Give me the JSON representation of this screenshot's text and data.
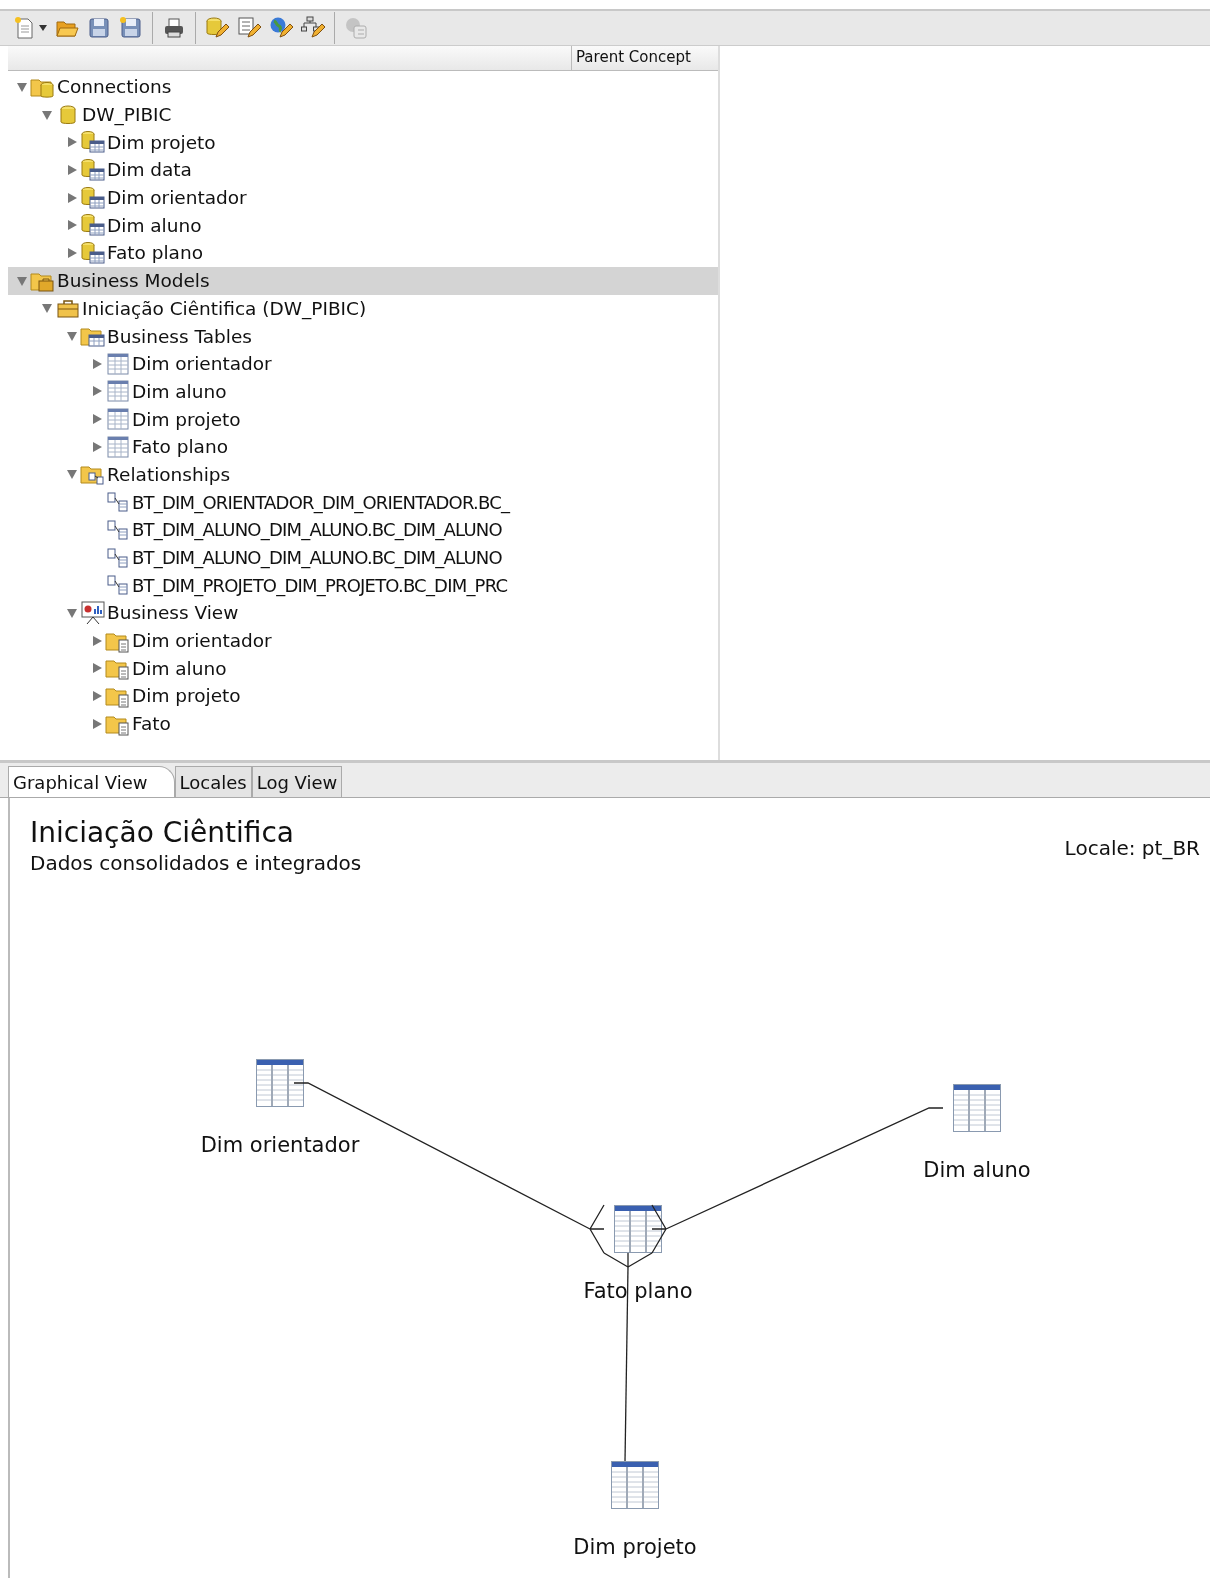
{
  "toolbar": {
    "buttons": [
      {
        "kind": "new",
        "disabled": false,
        "dropdown": true
      },
      {
        "kind": "open",
        "disabled": false,
        "dropdown": false
      },
      {
        "kind": "save",
        "disabled": false,
        "dropdown": false
      },
      {
        "kind": "save-as",
        "disabled": false,
        "dropdown": false
      },
      {
        "kind": "print",
        "disabled": false,
        "dropdown": false
      },
      {
        "kind": "edit-connection",
        "disabled": false,
        "dropdown": false
      },
      {
        "kind": "edit-table",
        "disabled": false,
        "dropdown": false
      },
      {
        "kind": "edit-locale",
        "disabled": false,
        "dropdown": false
      },
      {
        "kind": "edit-hierarchy",
        "disabled": false,
        "dropdown": false
      },
      {
        "kind": "security",
        "disabled": true,
        "dropdown": false
      }
    ]
  },
  "tree": {
    "column_header": "Parent Concept",
    "items": [
      {
        "label": "Connections",
        "kind": "connections",
        "expanded": true,
        "selected": false,
        "children": [
          {
            "label": "DW_PIBIC",
            "kind": "database",
            "expanded": true,
            "selected": false,
            "children": [
              {
                "label": "Dim projeto",
                "kind": "physical-table",
                "expanded": false,
                "selected": false
              },
              {
                "label": "Dim data",
                "kind": "physical-table",
                "expanded": false,
                "selected": false
              },
              {
                "label": "Dim orientador",
                "kind": "physical-table",
                "expanded": false,
                "selected": false
              },
              {
                "label": "Dim aluno",
                "kind": "physical-table",
                "expanded": false,
                "selected": false
              },
              {
                "label": "Fato plano",
                "kind": "physical-table",
                "expanded": false,
                "selected": false
              }
            ]
          }
        ]
      },
      {
        "label": "Business Models",
        "kind": "business-models",
        "expanded": true,
        "selected": true,
        "children": [
          {
            "label": "Iniciação Ciêntifica (DW_PIBIC)",
            "kind": "model",
            "expanded": true,
            "selected": false,
            "children": [
              {
                "label": "Business Tables",
                "kind": "tables-folder",
                "expanded": true,
                "selected": false,
                "children": [
                  {
                    "label": "Dim orientador",
                    "kind": "business-table",
                    "expanded": false,
                    "selected": false
                  },
                  {
                    "label": "Dim aluno",
                    "kind": "business-table",
                    "expanded": false,
                    "selected": false
                  },
                  {
                    "label": "Dim projeto",
                    "kind": "business-table",
                    "expanded": false,
                    "selected": false
                  },
                  {
                    "label": "Fato plano",
                    "kind": "business-table",
                    "expanded": false,
                    "selected": false
                  }
                ]
              },
              {
                "label": "Relationships",
                "kind": "relationships-folder",
                "expanded": true,
                "selected": false,
                "children": [
                  {
                    "label": "BT_DIM_ORIENTADOR_DIM_ORIENTADOR.BC_",
                    "kind": "relationship",
                    "selected": false
                  },
                  {
                    "label": "BT_DIM_ALUNO_DIM_ALUNO.BC_DIM_ALUNO",
                    "kind": "relationship",
                    "selected": false
                  },
                  {
                    "label": "BT_DIM_ALUNO_DIM_ALUNO.BC_DIM_ALUNO",
                    "kind": "relationship",
                    "selected": false
                  },
                  {
                    "label": "BT_DIM_PROJETO_DIM_PROJETO.BC_DIM_PRC",
                    "kind": "relationship",
                    "selected": false
                  }
                ]
              },
              {
                "label": "Business View",
                "kind": "business-view",
                "expanded": true,
                "selected": false,
                "children": [
                  {
                    "label": "Dim orientador",
                    "kind": "category",
                    "expanded": false,
                    "selected": false
                  },
                  {
                    "label": "Dim aluno",
                    "kind": "category",
                    "expanded": false,
                    "selected": false
                  },
                  {
                    "label": "Dim projeto",
                    "kind": "category",
                    "expanded": false,
                    "selected": false
                  },
                  {
                    "label": "Fato",
                    "kind": "category",
                    "expanded": false,
                    "selected": false
                  }
                ]
              }
            ]
          }
        ]
      }
    ]
  },
  "tabs": [
    {
      "label": "Graphical View",
      "selected": true
    },
    {
      "label": "Locales",
      "selected": false
    },
    {
      "label": "Log View",
      "selected": false
    }
  ],
  "graphical_view": {
    "title": "Iniciação Ciêntifica",
    "subtitle": "Dados consolidados e integrados",
    "locale": "Locale: pt_BR",
    "nodes": [
      {
        "label": "Dim orientador"
      },
      {
        "label": "Dim aluno"
      },
      {
        "label": "Fato plano"
      },
      {
        "label": "Dim projeto"
      }
    ]
  }
}
